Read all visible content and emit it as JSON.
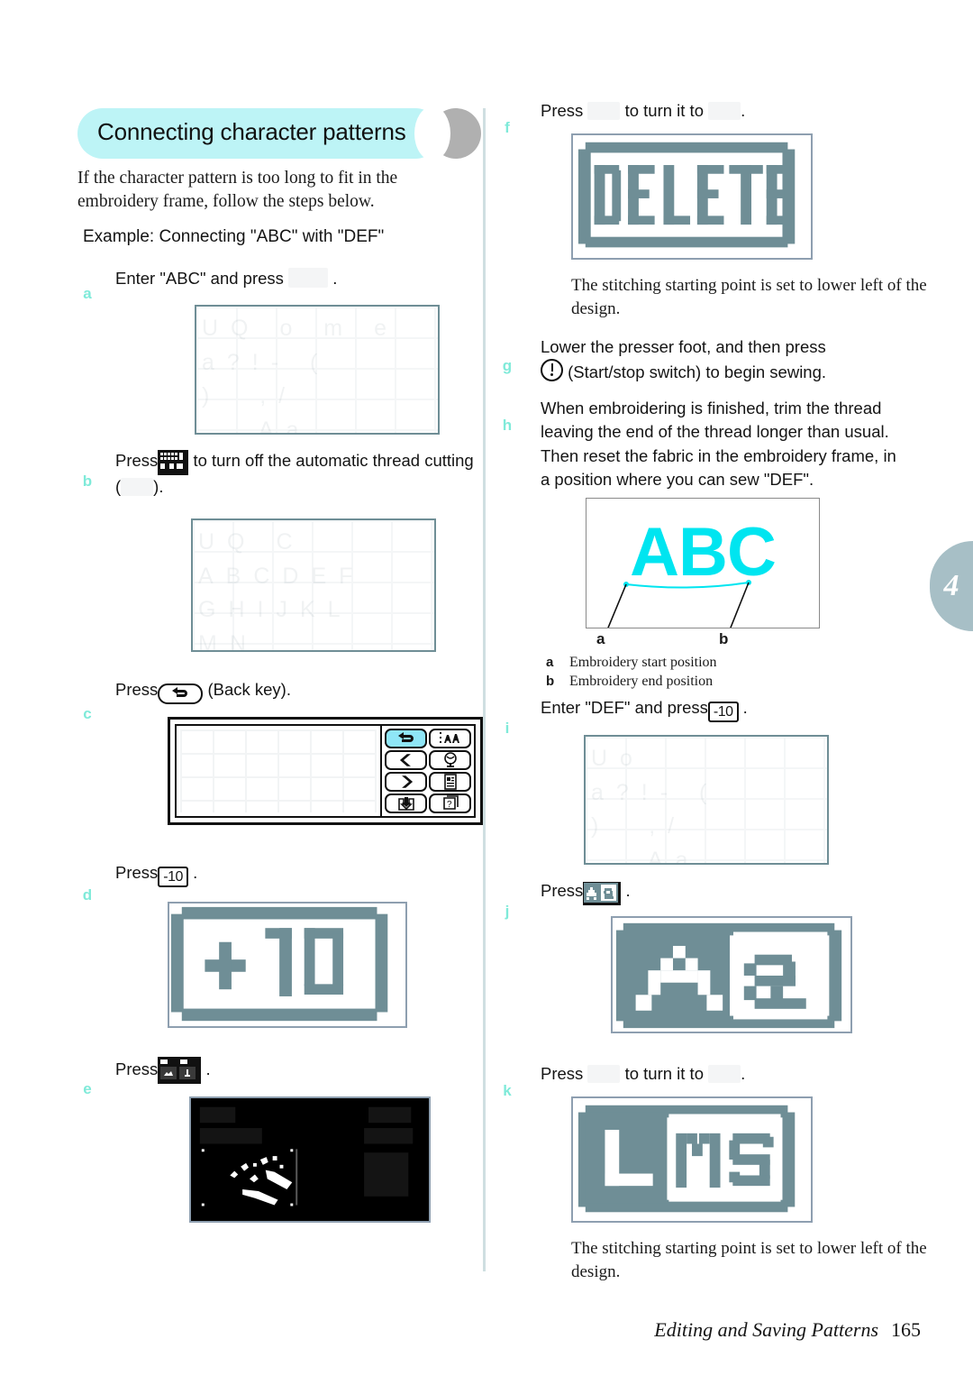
{
  "page": {
    "number": "165",
    "footer_title": "Editing and Saving Patterns",
    "chapter_tab": "4"
  },
  "section": {
    "heading": "Connecting character patterns",
    "intro": "If the character pattern is too long to fit in the embroidery frame, follow the steps below.",
    "example": "Example: Connecting \"ABC\" with \"DEF\""
  },
  "steps": {
    "a": {
      "letter": "a",
      "text_before": "Enter \"ABC\" and press",
      "icon": "set-key-icon",
      "text_after": "."
    },
    "b": {
      "letter": "b",
      "text_1": "Press",
      "icon_1": "lcd-thread-cut-icon",
      "text_2": "to turn off the automatic thread cutting (",
      "icon_2": "thread-cut-off-icon",
      "text_3": ")."
    },
    "c": {
      "letter": "c",
      "text_1": "Press",
      "keycap": "back-arrow-icon",
      "text_2": "(Back key).",
      "panel": {
        "keys": [
          "back-arrow-icon",
          "lettering-edit-icon",
          "left-arrow-icon",
          "needle-position-icon",
          "right-arrow-icon",
          "settings-page-icon",
          "memory-save-icon",
          "help-guide-icon"
        ],
        "active_key_index": 0
      }
    },
    "d": {
      "letter": "d",
      "text_1": "Press",
      "keycap": "-10",
      "text_2": ".",
      "lcd_label": "+10"
    },
    "e": {
      "letter": "e",
      "text_1": "Press",
      "icon": "lcd-two-key-icon",
      "text_2": "."
    },
    "f": {
      "letter": "f",
      "text_1": "Press",
      "icon_1": "faint-key-icon",
      "text_2": "to turn it to",
      "icon_2": "faint-value-icon",
      "text_3": ".",
      "lcd_label": "DELETE",
      "note": "The stitching starting point is set to lower left of the design."
    },
    "g": {
      "letter": "g",
      "text_1": "Lower the presser foot, and then press",
      "icon": "start-stop-switch-icon",
      "text_2": "(Start/stop switch) to begin sewing."
    },
    "h": {
      "letter": "h",
      "text": "When embroidering is finished, trim the thread leaving the end of the thread longer than usual. Then reset the fabric in the embroidery frame, in a position where you can sew \"DEF\"."
    },
    "i": {
      "letter": "i",
      "text_1": "Enter \"DEF\" and press",
      "keycap": "-10",
      "text_2": "."
    },
    "j": {
      "letter": "j",
      "text_1": "Press",
      "icon": "lcd-case-key-icon",
      "text_2": ".",
      "lcd_label": "Aa"
    },
    "k": {
      "letter": "k",
      "text_1": "Press",
      "icon_1": "faint-key-icon",
      "text_2": "to turn it to",
      "icon_2": "faint-value-icon",
      "text_3": ".",
      "lcd_label": "LMS",
      "note": "The stitching starting point is set to lower left of the design."
    }
  },
  "illustration": {
    "word": "ABC",
    "callout_a": "a",
    "callout_b": "b",
    "legend": [
      {
        "key": "a",
        "text": "Embroidery start position"
      },
      {
        "key": "b",
        "text": "Embroidery end position"
      }
    ]
  },
  "colors": {
    "banner": "#bdf4f6",
    "banner_knob": "#b0b0b0",
    "step_letter": "#7fead9",
    "lcd_pixel": "#6f8e96",
    "abc_cyan": "#00e5f0",
    "tab": "#a7bfc6",
    "divider": "#cfdfe1"
  }
}
